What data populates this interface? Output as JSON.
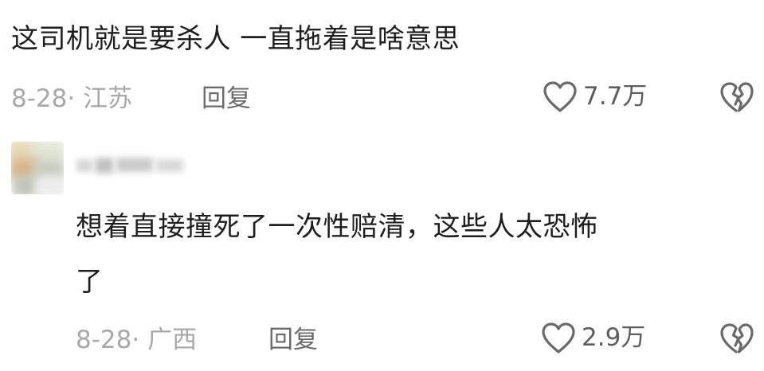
{
  "comments": [
    {
      "text": "这司机就是要杀人 一直拖着是啥意思",
      "meta": "8-28· 江苏",
      "reply_label": "回复",
      "likes": "7.7万"
    },
    {
      "text_line1": "想着直接撞死了一次性赔清，这些人太恐怖",
      "text_line2": "了",
      "meta": "8-28· 广西",
      "reply_label": "回复",
      "likes": "2.9万"
    }
  ],
  "colors": {
    "text": "#1e1e1e",
    "meta": "#a8a8a8",
    "reply": "#6b6b6b",
    "icon": "#6a6a6a"
  },
  "icons": {
    "like": "heart-outline-icon",
    "dislike": "broken-heart-icon"
  }
}
